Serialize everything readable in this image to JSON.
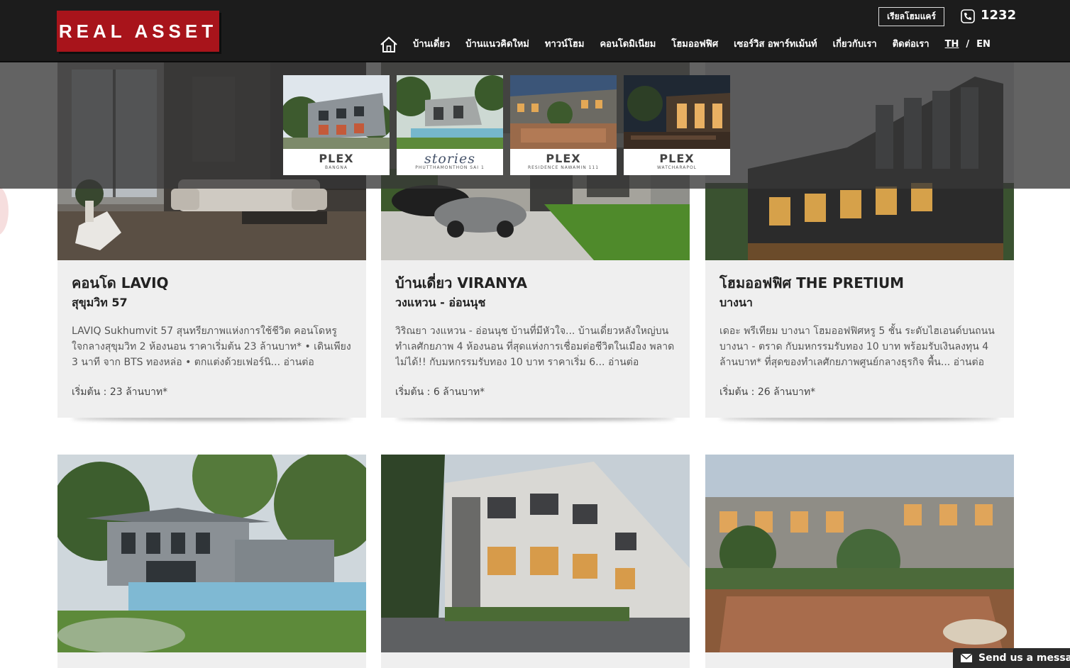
{
  "header": {
    "logo_text": "REAL ASSET",
    "homecare_label": "เรียลโฮมแคร์",
    "phone": "1232",
    "nav": [
      "บ้านเดี่ยว",
      "บ้านแนวคิดใหม่",
      "ทาวน์โฮม",
      "คอนโดมิเนียม",
      "โฮมออฟฟิศ",
      "เซอร์วิส อพาร์ทเม้นท์",
      "เกี่ยวกับเรา",
      "ติดต่อเรา"
    ],
    "lang_th": "TH",
    "lang_sep": "/",
    "lang_en": "EN"
  },
  "dropdown": [
    {
      "brand": "PLEX",
      "sub": "BANGNA"
    },
    {
      "brand": "stories",
      "sub": "PHUTTHAMONTHON SAI 1"
    },
    {
      "brand": "PLEX",
      "sub": "RESIDENCE NAWAMIN 111"
    },
    {
      "brand": "PLEX",
      "sub": "WATCHARAPOL"
    }
  ],
  "cards": [
    {
      "title": "คอนโด LAVIQ",
      "subtitle": "สุขุมวิท 57",
      "desc": "LAVIQ Sukhumvit 57 สุนทรียภาพแห่งการใช้ชีวิต คอนโดหรู ใจกลางสุขุมวิท 2 ห้องนอน ราคาเริ่มต้น 23 ล้านบาท* • เดินเพียง 3 นาที จาก BTS ทองหล่อ • ตกแต่งด้วยเฟอร์นิ... อ่านต่อ",
      "price": "เริ่มต้น : 23 ล้านบาท*"
    },
    {
      "title": "บ้านเดี่ยว VIRANYA",
      "subtitle": "วงแหวน - อ่อนนุช",
      "desc": "วิริณยา วงแหวน - อ่อนนุช บ้านที่มีหัวใจ... บ้านเดี่ยวหลังใหญ่บนทำเลศักยภาพ 4 ห้องนอน ที่สุดแห่งการเชื่อมต่อชีวิตในเมือง พลาดไม่ได้!! กับมหกรรมรับทอง 10 บาท ราคาเริ่ม 6... อ่านต่อ",
      "price": "เริ่มต้น : 6 ล้านบาท*"
    },
    {
      "title": "โฮมออฟฟิศ THE PRETIUM",
      "subtitle": "บางนา",
      "desc": "เดอะ พรีเทียม บางนา โฮมออฟฟิศหรู 5 ชั้น ระดับไฮเอนด์บนถนนบางนา - ตราด กับมหกรรมรับทอง 10 บาท พร้อมรับเงินลงทุน 4 ล้านบาท* ที่สุดของทำเลศักยภาพศูนย์กลางธุรกิจ พื้น... อ่านต่อ",
      "price": "เริ่มต้น : 26 ล้านบาท*"
    }
  ],
  "chat_label": "Send us a message",
  "colors": {
    "brand_red": "#a8141b",
    "header_bg": "#1c1c1c",
    "card_bg": "#efefef"
  }
}
